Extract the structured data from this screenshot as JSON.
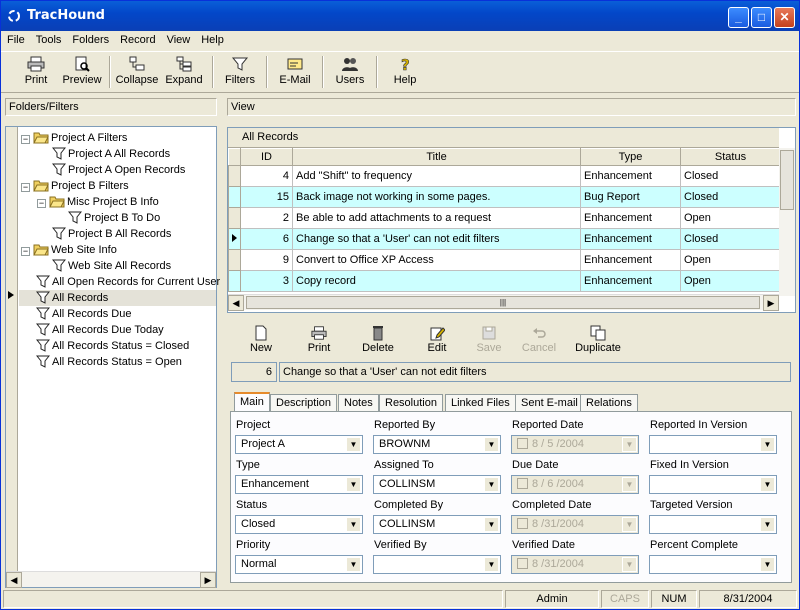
{
  "app": {
    "title": "TracHound"
  },
  "menu": [
    "File",
    "Tools",
    "Folders",
    "Record",
    "View",
    "Help"
  ],
  "toolbar": [
    "Print",
    "Preview",
    "Collapse",
    "Expand",
    "Filters",
    "E-Mail",
    "Users",
    "Help"
  ],
  "panels": {
    "left_title": "Folders/Filters",
    "right_title": "View"
  },
  "tree": [
    {
      "label": "Project A Filters",
      "type": "folder",
      "level": 0
    },
    {
      "label": "Project A All Records",
      "type": "filter",
      "level": 1
    },
    {
      "label": "Project A Open Records",
      "type": "filter",
      "level": 1
    },
    {
      "label": "Project B Filters",
      "type": "folder",
      "level": 0
    },
    {
      "label": "Misc Project B Info",
      "type": "folder",
      "level": 1
    },
    {
      "label": "Project B To Do",
      "type": "filter",
      "level": 2
    },
    {
      "label": "Project B All Records",
      "type": "filter",
      "level": 1
    },
    {
      "label": "Web Site Info",
      "type": "folder",
      "level": 0
    },
    {
      "label": "Web Site All Records",
      "type": "filter",
      "level": 1
    },
    {
      "label": "All Open Records for Current User",
      "type": "filter",
      "level": 0
    },
    {
      "label": "All Records",
      "type": "filter",
      "level": 0,
      "selected": true
    },
    {
      "label": "All Records Due",
      "type": "filter",
      "level": 0
    },
    {
      "label": "All Records Due Today",
      "type": "filter",
      "level": 0
    },
    {
      "label": "All Records Status = Closed",
      "type": "filter",
      "level": 0
    },
    {
      "label": "All Records Status = Open",
      "type": "filter",
      "level": 0
    }
  ],
  "grid": {
    "caption": "All Records",
    "columns": [
      "ID",
      "Title",
      "Type",
      "Status"
    ],
    "rows": [
      [
        "4",
        "Add \"Shift\" to frequency",
        "Enhancement",
        "Closed"
      ],
      [
        "15",
        "Back image not working in some pages.",
        "Bug Report",
        "Closed"
      ],
      [
        "2",
        "Be able to add attachments to a request",
        "Enhancement",
        "Open"
      ],
      [
        "6",
        "Change so that a 'User' can not edit filters",
        "Enhancement",
        "Closed"
      ],
      [
        "9",
        "Convert to Office XP Access",
        "Enhancement",
        "Open"
      ],
      [
        "3",
        "Copy record",
        "Enhancement",
        "Open"
      ]
    ]
  },
  "actions": [
    {
      "label": "New",
      "enabled": true
    },
    {
      "label": "Print",
      "enabled": true
    },
    {
      "label": "Delete",
      "enabled": true
    },
    {
      "label": "Edit",
      "enabled": true
    },
    {
      "label": "Save",
      "enabled": false
    },
    {
      "label": "Cancel",
      "enabled": false
    },
    {
      "label": "Duplicate",
      "enabled": true
    }
  ],
  "record": {
    "id": "6",
    "title": "Change so that a 'User' can not edit filters"
  },
  "tabs": [
    "Main",
    "Description",
    "Notes",
    "Resolution",
    "Linked Files",
    "Sent E-mail",
    "Relations"
  ],
  "form": {
    "project": {
      "label": "Project",
      "value": "Project A"
    },
    "reported_by": {
      "label": "Reported By",
      "value": "BROWNM"
    },
    "reported_date": {
      "label": "Reported Date",
      "value": "8 / 5 /2004"
    },
    "reported_in_version": {
      "label": "Reported In Version",
      "value": ""
    },
    "type": {
      "label": "Type",
      "value": "Enhancement"
    },
    "assigned_to": {
      "label": "Assigned To",
      "value": "COLLINSM"
    },
    "due_date": {
      "label": "Due Date",
      "value": "8 / 6 /2004"
    },
    "fixed_in_version": {
      "label": "Fixed In Version",
      "value": ""
    },
    "status": {
      "label": "Status",
      "value": "Closed"
    },
    "completed_by": {
      "label": "Completed By",
      "value": "COLLINSM"
    },
    "completed_date": {
      "label": "Completed Date",
      "value": "8 /31/2004"
    },
    "targeted_version": {
      "label": "Targeted Version",
      "value": ""
    },
    "priority": {
      "label": "Priority",
      "value": "Normal"
    },
    "verified_by": {
      "label": "Verified By",
      "value": ""
    },
    "verified_date": {
      "label": "Verified Date",
      "value": "8 /31/2004"
    },
    "percent_complete": {
      "label": "Percent Complete",
      "value": ""
    }
  },
  "status": {
    "user": "Admin",
    "caps": "CAPS",
    "num": "NUM",
    "date": "8/31/2004"
  }
}
